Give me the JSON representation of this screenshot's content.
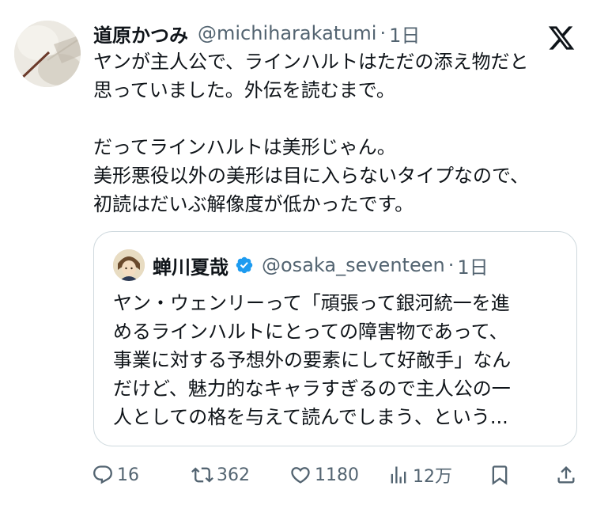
{
  "tweet": {
    "author_name": "道原かつみ",
    "author_handle": "@michiharakatumi",
    "separator": "·",
    "time": "1日",
    "lines": [
      "ヤンが主人公で、ラインハルトはただの添え物だと",
      "思っていました。外伝を読むまで。",
      "",
      "だってラインハルトは美形じゃん。",
      "美形悪役以外の美形は目に入らないタイプなので、",
      "初読はだいぶ解像度が低かったです。"
    ]
  },
  "quoted": {
    "author_name": "蝉川夏哉",
    "author_handle": "@osaka_seventeen",
    "separator": "·",
    "time": "1日",
    "lines": [
      "ヤン・ウェンリーって「頑張って銀河統一を進",
      "めるラインハルトにとっての障害物であって、",
      "事業に対する予想外の要素にして好敵手」なん",
      "だけど、魅力的なキャラすぎるので主人公の一",
      "人としての格を与えて読んでしまう、という..."
    ]
  },
  "actions": {
    "replies": "16",
    "reposts": "362",
    "likes": "1180",
    "views": "12万"
  },
  "icons": [
    "x-logo-icon",
    "verified-badge-icon",
    "reply-icon",
    "repost-icon",
    "like-icon",
    "views-icon",
    "bookmark-icon",
    "share-icon"
  ],
  "colors": {
    "text": "#0f1419",
    "secondary": "#536471",
    "border": "#cfd9de",
    "verified": "#1d9bf0"
  }
}
